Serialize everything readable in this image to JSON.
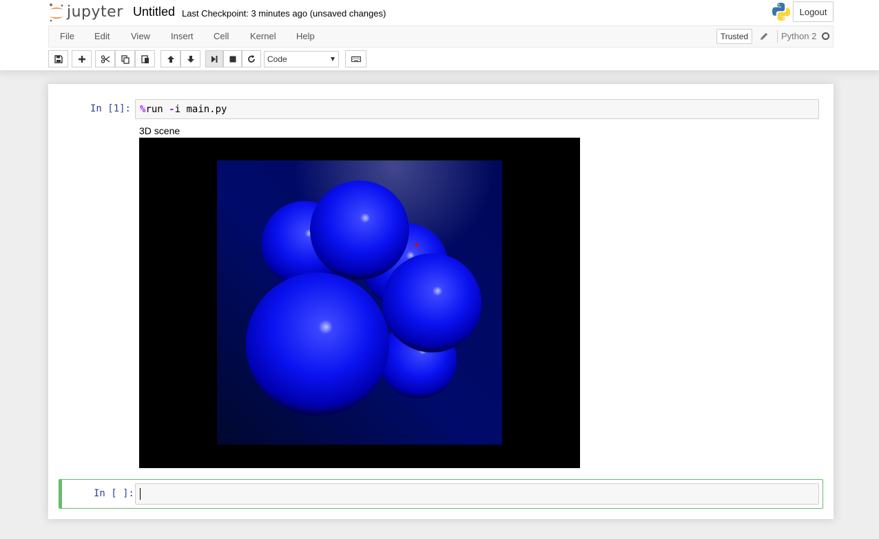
{
  "header": {
    "logo_text": "jupyter",
    "notebook_name": "Untitled",
    "checkpoint": "Last Checkpoint: 3 minutes ago (unsaved changes)",
    "logout_label": "Logout"
  },
  "menubar": {
    "items": [
      "File",
      "Edit",
      "View",
      "Insert",
      "Cell",
      "Kernel",
      "Help"
    ],
    "trusted_label": "Trusted",
    "kernel_name": "Python 2"
  },
  "toolbar": {
    "buttons": [
      "save-icon",
      "plus-icon",
      "cut-icon",
      "copy-icon",
      "paste-icon",
      "arrow-up-icon",
      "arrow-down-icon",
      "run-icon",
      "stop-icon",
      "restart-icon",
      "keyboard-icon"
    ],
    "cell_type": "Code"
  },
  "cells": [
    {
      "prompt": "In [1]:",
      "code_magic": "%",
      "code_magic_word": "run",
      "code_space": " ",
      "code_flag_op": "-",
      "code_rest": "i main.py",
      "output_label": "3D scene"
    },
    {
      "prompt": "In [ ]:",
      "code": ""
    }
  ],
  "colors": {
    "sphere": "#0000ff",
    "scene_background": "#000000",
    "panel_background": "#000a5a",
    "selected_cell_border": "#66bb6a",
    "prompt": "#303f9f"
  }
}
